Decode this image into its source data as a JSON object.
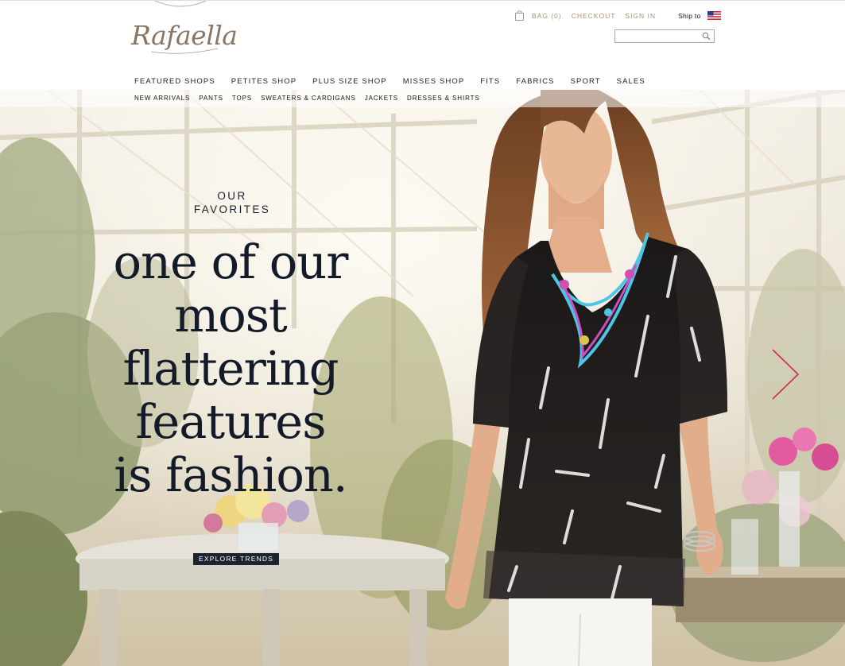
{
  "brand": {
    "logo_text": "Rafaella"
  },
  "utility": {
    "bag_label": "BAG (0)",
    "checkout_label": "CHECKOUT",
    "signin_label": "SIGN IN",
    "ship_to_label": "Ship to"
  },
  "search": {
    "value": "",
    "placeholder": ""
  },
  "main_nav": [
    "FEATURED SHOPS",
    "PETITES SHOP",
    "PLUS SIZE SHOP",
    "MISSES SHOP",
    "FITS",
    "FABRICS",
    "SPORT",
    "SALES"
  ],
  "sub_nav": [
    "NEW ARRIVALS",
    "PANTS",
    "TOPS",
    "SWEATERS & CARDIGANS",
    "JACKETS",
    "DRESSES & SHIRTS"
  ],
  "hero": {
    "kicker_line1": "OUR",
    "kicker_line2": "FAVORITES",
    "headline": [
      "one of our",
      "most",
      "flattering",
      "features",
      "is fashion."
    ],
    "cta_label": "EXPLORE TRENDS"
  },
  "colors": {
    "accent_tan": "#a88f74",
    "headline_navy": "#141b28",
    "cta_bg": "#1c2430",
    "arrow_red": "#c8314a"
  },
  "icons": [
    "bag-icon",
    "us-flag-icon",
    "search-icon",
    "chevron-right-icon"
  ]
}
